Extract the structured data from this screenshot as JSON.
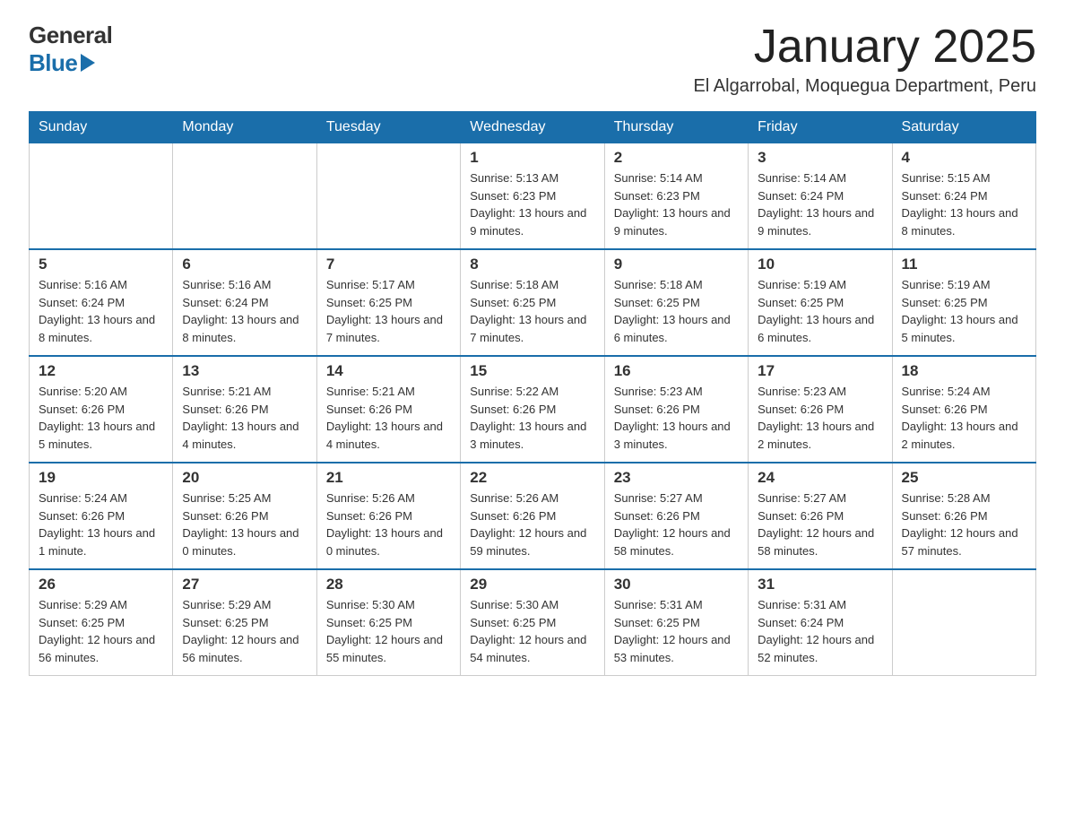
{
  "header": {
    "logo_general": "General",
    "logo_blue": "Blue",
    "month_title": "January 2025",
    "location": "El Algarrobal, Moquegua Department, Peru"
  },
  "days_of_week": [
    "Sunday",
    "Monday",
    "Tuesday",
    "Wednesday",
    "Thursday",
    "Friday",
    "Saturday"
  ],
  "weeks": [
    [
      {
        "day": "",
        "info": ""
      },
      {
        "day": "",
        "info": ""
      },
      {
        "day": "",
        "info": ""
      },
      {
        "day": "1",
        "info": "Sunrise: 5:13 AM\nSunset: 6:23 PM\nDaylight: 13 hours and 9 minutes."
      },
      {
        "day": "2",
        "info": "Sunrise: 5:14 AM\nSunset: 6:23 PM\nDaylight: 13 hours and 9 minutes."
      },
      {
        "day": "3",
        "info": "Sunrise: 5:14 AM\nSunset: 6:24 PM\nDaylight: 13 hours and 9 minutes."
      },
      {
        "day": "4",
        "info": "Sunrise: 5:15 AM\nSunset: 6:24 PM\nDaylight: 13 hours and 8 minutes."
      }
    ],
    [
      {
        "day": "5",
        "info": "Sunrise: 5:16 AM\nSunset: 6:24 PM\nDaylight: 13 hours and 8 minutes."
      },
      {
        "day": "6",
        "info": "Sunrise: 5:16 AM\nSunset: 6:24 PM\nDaylight: 13 hours and 8 minutes."
      },
      {
        "day": "7",
        "info": "Sunrise: 5:17 AM\nSunset: 6:25 PM\nDaylight: 13 hours and 7 minutes."
      },
      {
        "day": "8",
        "info": "Sunrise: 5:18 AM\nSunset: 6:25 PM\nDaylight: 13 hours and 7 minutes."
      },
      {
        "day": "9",
        "info": "Sunrise: 5:18 AM\nSunset: 6:25 PM\nDaylight: 13 hours and 6 minutes."
      },
      {
        "day": "10",
        "info": "Sunrise: 5:19 AM\nSunset: 6:25 PM\nDaylight: 13 hours and 6 minutes."
      },
      {
        "day": "11",
        "info": "Sunrise: 5:19 AM\nSunset: 6:25 PM\nDaylight: 13 hours and 5 minutes."
      }
    ],
    [
      {
        "day": "12",
        "info": "Sunrise: 5:20 AM\nSunset: 6:26 PM\nDaylight: 13 hours and 5 minutes."
      },
      {
        "day": "13",
        "info": "Sunrise: 5:21 AM\nSunset: 6:26 PM\nDaylight: 13 hours and 4 minutes."
      },
      {
        "day": "14",
        "info": "Sunrise: 5:21 AM\nSunset: 6:26 PM\nDaylight: 13 hours and 4 minutes."
      },
      {
        "day": "15",
        "info": "Sunrise: 5:22 AM\nSunset: 6:26 PM\nDaylight: 13 hours and 3 minutes."
      },
      {
        "day": "16",
        "info": "Sunrise: 5:23 AM\nSunset: 6:26 PM\nDaylight: 13 hours and 3 minutes."
      },
      {
        "day": "17",
        "info": "Sunrise: 5:23 AM\nSunset: 6:26 PM\nDaylight: 13 hours and 2 minutes."
      },
      {
        "day": "18",
        "info": "Sunrise: 5:24 AM\nSunset: 6:26 PM\nDaylight: 13 hours and 2 minutes."
      }
    ],
    [
      {
        "day": "19",
        "info": "Sunrise: 5:24 AM\nSunset: 6:26 PM\nDaylight: 13 hours and 1 minute."
      },
      {
        "day": "20",
        "info": "Sunrise: 5:25 AM\nSunset: 6:26 PM\nDaylight: 13 hours and 0 minutes."
      },
      {
        "day": "21",
        "info": "Sunrise: 5:26 AM\nSunset: 6:26 PM\nDaylight: 13 hours and 0 minutes."
      },
      {
        "day": "22",
        "info": "Sunrise: 5:26 AM\nSunset: 6:26 PM\nDaylight: 12 hours and 59 minutes."
      },
      {
        "day": "23",
        "info": "Sunrise: 5:27 AM\nSunset: 6:26 PM\nDaylight: 12 hours and 58 minutes."
      },
      {
        "day": "24",
        "info": "Sunrise: 5:27 AM\nSunset: 6:26 PM\nDaylight: 12 hours and 58 minutes."
      },
      {
        "day": "25",
        "info": "Sunrise: 5:28 AM\nSunset: 6:26 PM\nDaylight: 12 hours and 57 minutes."
      }
    ],
    [
      {
        "day": "26",
        "info": "Sunrise: 5:29 AM\nSunset: 6:25 PM\nDaylight: 12 hours and 56 minutes."
      },
      {
        "day": "27",
        "info": "Sunrise: 5:29 AM\nSunset: 6:25 PM\nDaylight: 12 hours and 56 minutes."
      },
      {
        "day": "28",
        "info": "Sunrise: 5:30 AM\nSunset: 6:25 PM\nDaylight: 12 hours and 55 minutes."
      },
      {
        "day": "29",
        "info": "Sunrise: 5:30 AM\nSunset: 6:25 PM\nDaylight: 12 hours and 54 minutes."
      },
      {
        "day": "30",
        "info": "Sunrise: 5:31 AM\nSunset: 6:25 PM\nDaylight: 12 hours and 53 minutes."
      },
      {
        "day": "31",
        "info": "Sunrise: 5:31 AM\nSunset: 6:24 PM\nDaylight: 12 hours and 52 minutes."
      },
      {
        "day": "",
        "info": ""
      }
    ]
  ]
}
